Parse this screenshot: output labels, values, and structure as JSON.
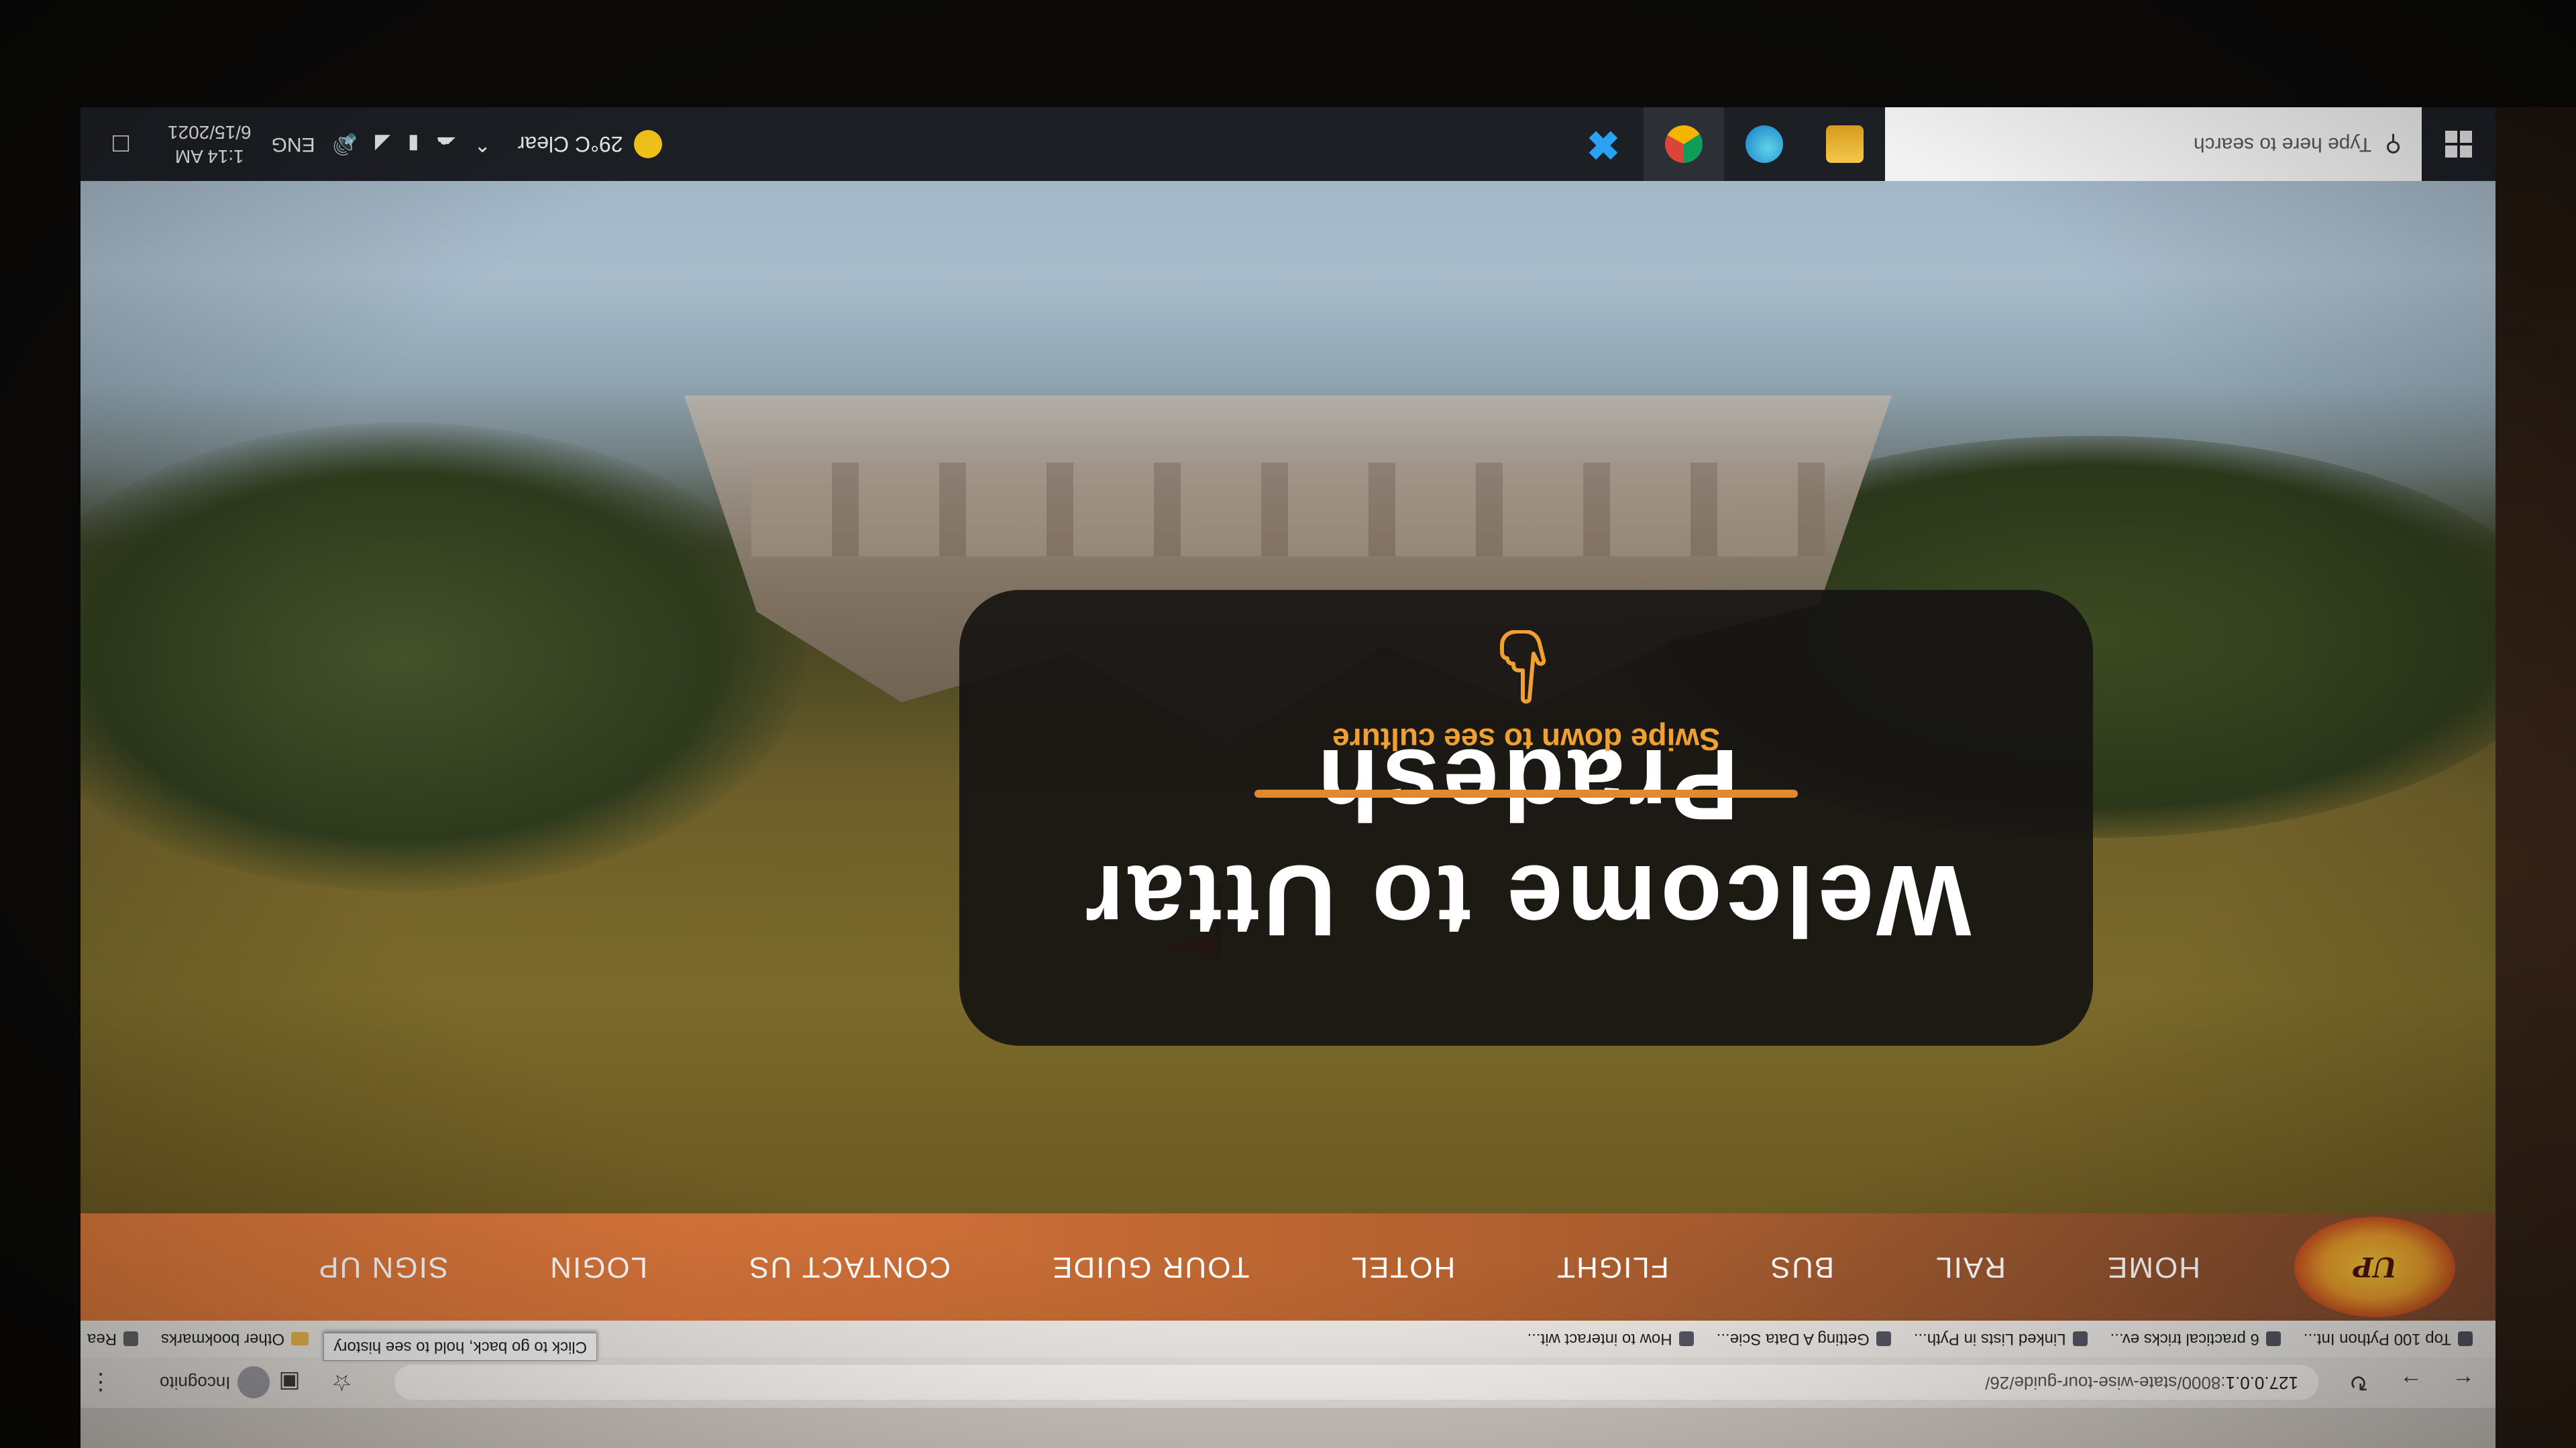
{
  "browser": {
    "url_host": "127.0.0.1",
    "url_path": ":8000/state-wise-tour-guide/26/",
    "back_tooltip": "Click to go back, hold to see history",
    "incognito_label": "Incognito",
    "bookmarks": [
      "Top 100 Python Int...",
      "6 practical tricks ev...",
      "Linked Lists in Pyth...",
      "Getting A Data Scie...",
      "How to interact wit..."
    ],
    "bookmarks_overflow": "»",
    "other_bookmarks": "Other bookmarks",
    "reading_list": "Rea"
  },
  "site": {
    "logo_text": "UP",
    "nav": [
      "HOME",
      "RAIL",
      "BUS",
      "FLIGHT",
      "HOTEL",
      "TOUR GUIDE",
      "CONTACT US",
      "LOGIN",
      "SIGN UP"
    ],
    "hero": {
      "title": "Welcome to Uttar Pradesh",
      "subtitle": "Swipe down to see culture",
      "accent_color": "#e08a2f"
    }
  },
  "taskbar": {
    "search_placeholder": "Type here to search",
    "weather": "29°C  Clear",
    "language": "ENG",
    "time": "1:14 AM",
    "date": "6/15/2021"
  },
  "colors": {
    "nav_gradient_start": "#7e4a2e",
    "nav_gradient_end": "#e07b3c",
    "card_bg": "#161412",
    "taskbar_bg": "#1c1f24"
  }
}
